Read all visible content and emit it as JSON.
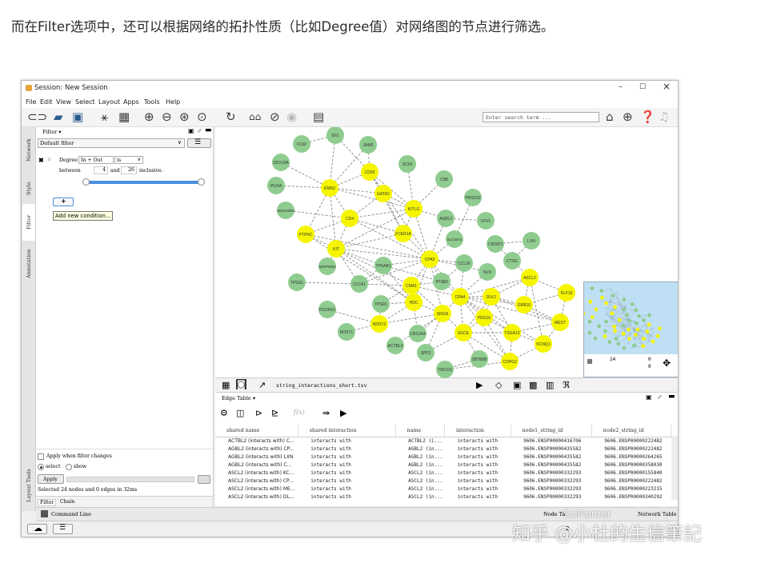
{
  "caption": "而在Filter选项中，还可以根据网络的拓扑性质（比如Degree值）对网络图的节点进行筛选。",
  "window": {
    "title": "Session: New Session",
    "minimize": "–",
    "maximize": "☐",
    "close": "×"
  },
  "menu": [
    "File",
    "Edit",
    "View",
    "Select",
    "Layout",
    "Apps",
    "Tools",
    "Help"
  ],
  "search": {
    "placeholder": "Enter search term ..."
  },
  "vertical_tabs": [
    "Network",
    "Style",
    "Filter",
    "Annotation"
  ],
  "vertical_tabs_bottom": "Layout Tools",
  "filter_panel": {
    "header": "Filter ▾",
    "preset": "Default filter",
    "condition": {
      "name": "Degree",
      "mode": "In + Out",
      "op": "is",
      "between_label": "between",
      "low": "4",
      "and_label": "and",
      "high": "26",
      "suffix": "inclusive."
    },
    "add_button": "+",
    "tooltip": "Add new condition...",
    "apply_when_changed": "Apply when filter changes",
    "radio_select": "select",
    "radio_show": "show",
    "apply_button": "Apply",
    "status": "Selected 24 nodes and 0 edges in 32ms",
    "tab_filter": "Filter",
    "tab_chain": "Chain"
  },
  "network": {
    "nodes": [
      {
        "label": "IDI1",
        "hl": false
      },
      {
        "label": "F11R",
        "hl": false
      },
      {
        "label": "JAM3",
        "hl": false
      },
      {
        "label": "DDX19A",
        "hl": false
      },
      {
        "label": "CD55",
        "hl": true
      },
      {
        "label": "SCIN",
        "hl": false
      },
      {
        "label": "PILRA",
        "hl": false
      },
      {
        "label": "EMR2",
        "hl": true
      },
      {
        "label": "GATA2",
        "hl": true
      },
      {
        "label": "C8B",
        "hl": false
      },
      {
        "label": "HDNC9982",
        "hl": false
      },
      {
        "label": "KITLG",
        "hl": true
      },
      {
        "label": "PRSS33",
        "hl": false
      },
      {
        "label": "CD4",
        "hl": true
      },
      {
        "label": "AGBL2",
        "hl": false
      },
      {
        "label": "CPVL",
        "hl": false
      },
      {
        "label": "PTPRC",
        "hl": true
      },
      {
        "label": "FCER1A",
        "hl": true
      },
      {
        "label": "SLC45A3",
        "hl": false
      },
      {
        "label": "CRISP3",
        "hl": false
      },
      {
        "label": "LXN",
        "hl": false
      },
      {
        "label": "KIT",
        "hl": true
      },
      {
        "label": "CPA3",
        "hl": true
      },
      {
        "label": "SERPINB3",
        "hl": false
      },
      {
        "label": "TPSAB1",
        "hl": false
      },
      {
        "label": "CCL26",
        "hl": false
      },
      {
        "label": "CTSG",
        "hl": false
      },
      {
        "label": "NLN",
        "hl": false
      },
      {
        "label": "TPSG1",
        "hl": false
      },
      {
        "label": "CLCA1",
        "hl": false
      },
      {
        "label": "TPSB2",
        "hl": false
      },
      {
        "label": "ASCL2",
        "hl": true
      },
      {
        "label": "CMA1",
        "hl": true
      },
      {
        "label": "KLF16",
        "hl": true
      },
      {
        "label": "CPA4",
        "hl": true
      },
      {
        "label": "DLK1",
        "hl": true
      },
      {
        "label": "HDC",
        "hl": true
      },
      {
        "label": "TPSD1",
        "hl": false
      },
      {
        "label": "GRB10",
        "hl": true
      },
      {
        "label": "PCDH15",
        "hl": false
      },
      {
        "label": "SRGN",
        "hl": true
      },
      {
        "label": "PEG10",
        "hl": true
      },
      {
        "label": "MEST",
        "hl": true
      },
      {
        "label": "NDST2",
        "hl": true
      },
      {
        "label": "NDST1",
        "hl": false
      },
      {
        "label": "CRS1A4",
        "hl": false
      },
      {
        "label": "SGCE",
        "hl": true
      },
      {
        "label": "TSGA13",
        "hl": true
      },
      {
        "label": "KCNQ1",
        "hl": true
      },
      {
        "label": "ACTBL2",
        "hl": false
      },
      {
        "label": "SPP2",
        "hl": false
      },
      {
        "label": "ZBTB8B",
        "hl": false
      },
      {
        "label": "COPG2",
        "hl": true
      },
      {
        "label": "TMCO3",
        "hl": false
      }
    ],
    "node_color": "#8fcc8f",
    "highlight_color": "#f5f500",
    "overview": {
      "zoom": "24",
      "count_a": "0",
      "count_b": "0"
    }
  },
  "network_file": "string_interactions_short.tsv",
  "edge_table": {
    "header": "Edge Table ▾",
    "formula": "f(x)",
    "columns": [
      "shared name",
      "shared interaction",
      "name",
      "interaction",
      "node1_string_id",
      "node2_string_id"
    ],
    "rows": [
      [
        "ACTBL2 (interacts with) C...",
        "interacts with",
        "ACTBL2 (i...",
        "interacts with",
        "9606.ENSP00000416706",
        "9606.ENSP00000222482"
      ],
      [
        "AGBL2 (interacts with) CP...",
        "interacts with",
        "AGBL2 (in...",
        "interacts with",
        "9606.ENSP00000435582",
        "9606.ENSP00000222482"
      ],
      [
        "AGBL2 (interacts with) LXN",
        "interacts with",
        "AGBL2 (in...",
        "interacts with",
        "9606.ENSP00000435582",
        "9606.ENSP00000264265"
      ],
      [
        "AGBL2 (interacts with) C...",
        "interacts with",
        "AGBL2 (in...",
        "interacts with",
        "9606.ENSP00000435582",
        "9606.ENSP00000358030"
      ],
      [
        "ASCL2 (interacts with) KC...",
        "interacts with",
        "ASCL2 (in...",
        "interacts with",
        "9606.ENSP00000332293",
        "9606.ENSP00000155840"
      ],
      [
        "ASCL2 (interacts with) CP...",
        "interacts with",
        "ASCL2 (in...",
        "interacts with",
        "9606.ENSP00000332293",
        "9606.ENSP00000222482"
      ],
      [
        "ASCL2 (interacts with) ME...",
        "interacts with",
        "ASCL2 (in...",
        "interacts with",
        "9606.ENSP00000332293",
        "9606.ENSP00000223215"
      ],
      [
        "ASCL2 (interacts with) DL...",
        "interacts with",
        "ASCL2 (in...",
        "interacts with",
        "9606.ENSP00000332293",
        "9606.ENSP00000340292"
      ]
    ]
  },
  "bottom": {
    "command_line": "Command Line",
    "node_table": "Node Ta",
    "network_table": "Network Table",
    "status_frag": "2"
  },
  "watermark": "知乎 @小杜的生信筆記",
  "watermark_small": "SciPainter"
}
